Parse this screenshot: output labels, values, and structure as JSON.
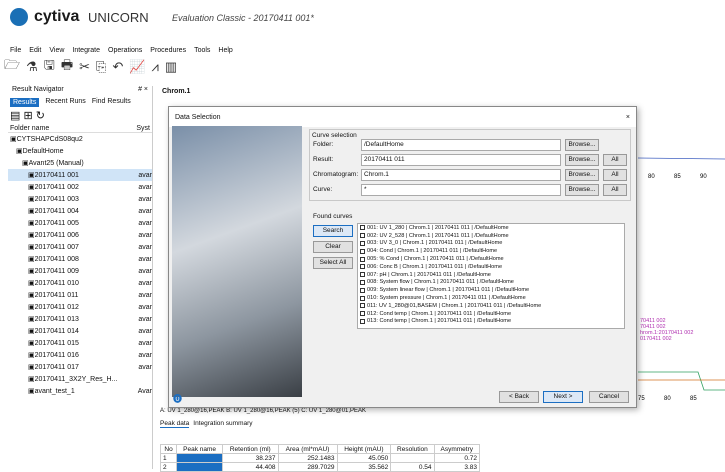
{
  "app": {
    "brand": "cytiva",
    "name": "UNICORN",
    "doc": "Evaluation Classic - 20170411 001*"
  },
  "menu": [
    "File",
    "Edit",
    "View",
    "Integrate",
    "Operations",
    "Procedures",
    "Tools",
    "Help"
  ],
  "left": {
    "title": "Result Navigator",
    "pin": "# ×",
    "tabs": [
      "Results",
      "Recent Runs",
      "Find Results"
    ],
    "col1": "Folder name",
    "col2": "Syst",
    "tree": [
      {
        "t": "CYTSHAPCdS08qu2",
        "i": 0
      },
      {
        "t": "DefaultHome",
        "i": 1
      },
      {
        "t": "Avant25 (Manual)",
        "i": 2
      },
      {
        "t": "20170411 001",
        "s": "avar",
        "i": 3
      },
      {
        "t": "20170411 002",
        "s": "avar",
        "i": 3
      },
      {
        "t": "20170411 003",
        "s": "avar",
        "i": 3
      },
      {
        "t": "20170411 004",
        "s": "avar",
        "i": 3
      },
      {
        "t": "20170411 005",
        "s": "avar",
        "i": 3
      },
      {
        "t": "20170411 006",
        "s": "avar",
        "i": 3
      },
      {
        "t": "20170411 007",
        "s": "avar",
        "i": 3
      },
      {
        "t": "20170411 008",
        "s": "avar",
        "i": 3
      },
      {
        "t": "20170411 009",
        "s": "avar",
        "i": 3
      },
      {
        "t": "20170411 010",
        "s": "avar",
        "i": 3
      },
      {
        "t": "20170411 011",
        "s": "avar",
        "i": 3
      },
      {
        "t": "20170411 012",
        "s": "avar",
        "i": 3
      },
      {
        "t": "20170411 013",
        "s": "avar",
        "i": 3
      },
      {
        "t": "20170411 014",
        "s": "avar",
        "i": 3
      },
      {
        "t": "20170411 015",
        "s": "avar",
        "i": 3
      },
      {
        "t": "20170411 016",
        "s": "avar",
        "i": 3
      },
      {
        "t": "20170411 017",
        "s": "avar",
        "i": 3
      },
      {
        "t": "20170411_3X2Y_Res_H...",
        "s": "",
        "i": 3
      },
      {
        "t": "avant_test_1",
        "s": "Avar",
        "i": 3
      }
    ]
  },
  "chrom": {
    "title": "Chrom.1",
    "ticks": [
      "80",
      "85",
      "90"
    ],
    "ticks2": [
      "75",
      "80",
      "85"
    ],
    "legend": [
      "70411 002",
      "70411 002",
      "hrom.1:20170411 002",
      "0170411 002"
    ]
  },
  "dialog": {
    "title": "Data Selection",
    "close": "×",
    "group": "Curve selection",
    "folder_lbl": "Folder:",
    "folder": "/DefaultHome",
    "result_lbl": "Result:",
    "result": "20170411 011",
    "chrom_lbl": "Chromatogram:",
    "chrom": "Chrom.1",
    "curve_lbl": "Curve:",
    "curve": "*",
    "browse": "Browse...",
    "all": "All",
    "found": "Found curves",
    "search": "Search",
    "clear": "Clear",
    "selall": "Select All",
    "curves": [
      "001: UV 1_280 | Chrom.1 | 20170411 011 | /DefaultHome",
      "002: UV 2_528 | Chrom.1 | 20170411 011 | /DefaultHome",
      "003: UV 3_0 | Chrom.1 | 20170411 011 | /DefaultHome",
      "004: Cond | Chrom.1 | 20170411 011 | /DefaultHome",
      "005: % Cond | Chrom.1 | 20170411 011 | /DefaultHome",
      "006: Conc B | Chrom.1 | 20170411 011 | /DefaultHome",
      "007: pH | Chrom.1 | 20170411 011 | /DefaultHome",
      "008: System flow | Chrom.1 | 20170411 011 | /DefaultHome",
      "009: System linear flow | Chrom.1 | 20170411 011 | /DefaultHome",
      "010: System pressure | Chrom.1 | 20170411 011 | /DefaultHome",
      "011: UV 1_280@01,BASEM | Chrom.1 | 20170411 011 | /DefaultHome",
      "012: Cond temp | Chrom.1 | 20170411 011 | /DefaultHome",
      "013: Cond temp | Chrom.1 | 20170411 011 | /DefaultHome"
    ],
    "back": "< Back",
    "next": "Next >",
    "cancel": "Cancel"
  },
  "peaks": {
    "series": "A: UV 1_280@16,PEAK   B: UV 1_280@16,PEAK (5)   C: UV 1_280@01,PEAK",
    "tabs": [
      "Peak data",
      "Integration summary"
    ],
    "headers": [
      "No",
      "Peak name",
      "Retention (ml)",
      "Area (ml*mAU)",
      "Height (mAU)",
      "Resolution",
      "Asymmetry"
    ],
    "rows": [
      [
        "1",
        "",
        "38.237",
        "252.1483",
        "45.050",
        "",
        "0.72"
      ],
      [
        "2",
        "",
        "44.408",
        "289.7029",
        "35.562",
        "0.54",
        "3.83"
      ]
    ]
  }
}
